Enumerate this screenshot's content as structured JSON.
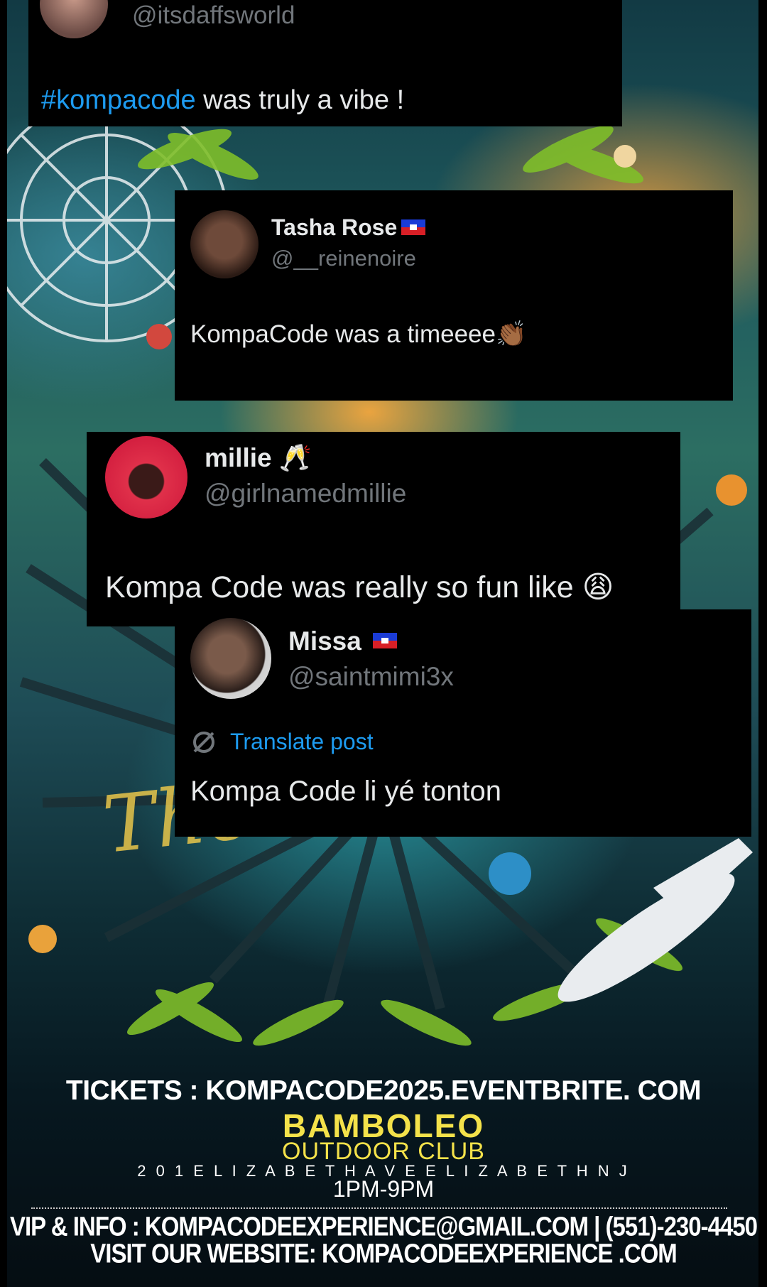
{
  "posts": [
    {
      "handle": "@itsdaffsworld",
      "text_tag": "#kompacode",
      "text_rest": " was truly a vibe !"
    },
    {
      "name": "Tasha Rose",
      "handle": "@__reinenoire",
      "text": "KompaCode was a timeeee",
      "emoji": "👏🏾"
    },
    {
      "name": "millie",
      "name_emoji": "🥂",
      "handle": "@girlnamedmillie",
      "text": "Kompa Code was really so fun like",
      "emoji": "😩"
    },
    {
      "name": "Missa",
      "handle": "@saintmimi3x",
      "translate": "Translate post",
      "text": "Kompa Code li yé tonton"
    }
  ],
  "poster": {
    "tickets": "TICKETS : KOMPACODE2025.EVENTBRITE. COM",
    "venue": "BAMBOLEO",
    "venue_sub": "OUTDOOR CLUB",
    "address": "2 0 1   E L I Z A B E T H   A V E   E L I Z A B E T H   N J",
    "time": "1PM-9PM",
    "vip": "VIP & INFO : KOMPACODEEXPERIENCE@GMAIL.COM | (551)-230-4450",
    "website": "VISIT OUR WEBSITE: KOMPACODEEXPERIENCE .COM"
  },
  "colors": {
    "link": "#1d9bf0",
    "venue": "#f4e24a",
    "card": "#000000"
  }
}
